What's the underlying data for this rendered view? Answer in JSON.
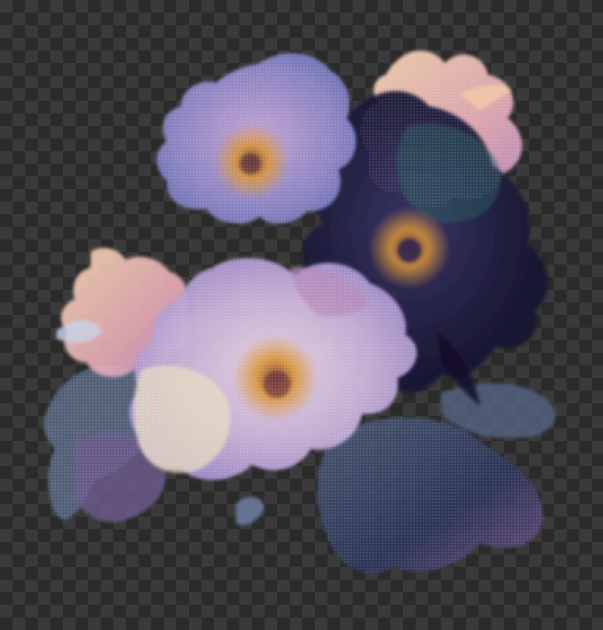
{
  "image": {
    "subject": "floral-bouquet",
    "background": "transparency-checkerboard",
    "colors": {
      "checker_light": "#3a3a3a",
      "checker_dark": "#2b2b2b",
      "lavender": "#9a86c8",
      "periwinkle": "#7d85c4",
      "indigo_dark": "#1c1a3a",
      "navy": "#2c3458",
      "peach": "#f0c6a4",
      "cream": "#efe4c8",
      "pink": "#d79ab8",
      "gold_center": "#d8953a",
      "slate_leaf": "#4a5a74"
    }
  }
}
